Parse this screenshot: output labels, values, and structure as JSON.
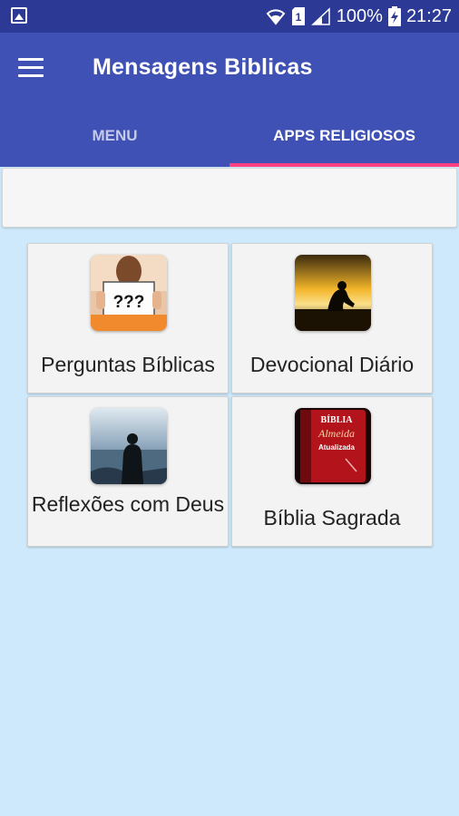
{
  "status_bar": {
    "battery": "100%",
    "time": "21:27",
    "sim_label": "1"
  },
  "app_bar": {
    "title": "Mensagens Biblicas"
  },
  "tabs": [
    {
      "label": "MENU",
      "active": false
    },
    {
      "label": "APPS RELIGIOSOS",
      "active": true
    }
  ],
  "apps": [
    {
      "label": "Perguntas Bíblicas",
      "icon": "question-board-icon",
      "icon_text": "???"
    },
    {
      "label": "Devocional Diário",
      "icon": "praying-silhouette-icon"
    },
    {
      "label": "Reflexões com Deus",
      "icon": "man-by-sea-icon"
    },
    {
      "label": "Bíblia Sagrada",
      "icon": "bible-book-icon",
      "icon_text": [
        "BÍBLIA",
        "Almeida",
        "Atualizada"
      ]
    }
  ],
  "colors": {
    "status_bar": "#2c3a96",
    "app_bar": "#3f51b5",
    "tab_indicator": "#ff4081",
    "background": "#cde9fb"
  }
}
